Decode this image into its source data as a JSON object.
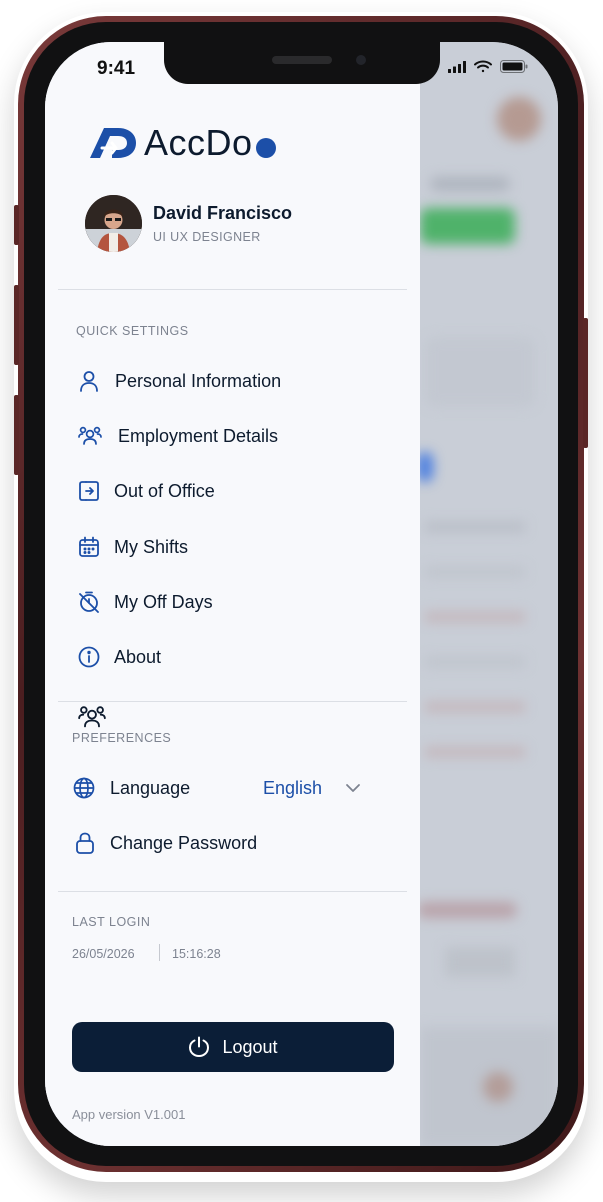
{
  "status_bar": {
    "time": "9:41"
  },
  "brand": {
    "logo_text": "AccDo"
  },
  "profile": {
    "name": "David Francisco",
    "role": "UI UX DESIGNER"
  },
  "quick_settings": {
    "label": "QUICK SETTINGS",
    "items": [
      {
        "label": "Personal Information",
        "icon": "user-icon"
      },
      {
        "label": "Employment Details",
        "icon": "users-icon"
      },
      {
        "label": "Out of Office",
        "icon": "sign-out-icon"
      },
      {
        "label": "My Shifts",
        "icon": "calendar-icon"
      },
      {
        "label": "My Off Days",
        "icon": "timer-off-icon"
      },
      {
        "label": "About",
        "icon": "info-icon"
      }
    ]
  },
  "preferences": {
    "label": "PREFERENCES",
    "language_label": "Language",
    "language_value": "English",
    "change_password_label": "Change Password"
  },
  "last_login": {
    "label": "LAST LOGIN",
    "date": "26/05/2026",
    "time": "15:16:28"
  },
  "logout_label": "Logout",
  "app_version": "App version V1.001",
  "colors": {
    "accent": "#1c4fa8",
    "dark": "#0b1e37",
    "text": "#0d1b2e",
    "muted": "#7d8390"
  }
}
